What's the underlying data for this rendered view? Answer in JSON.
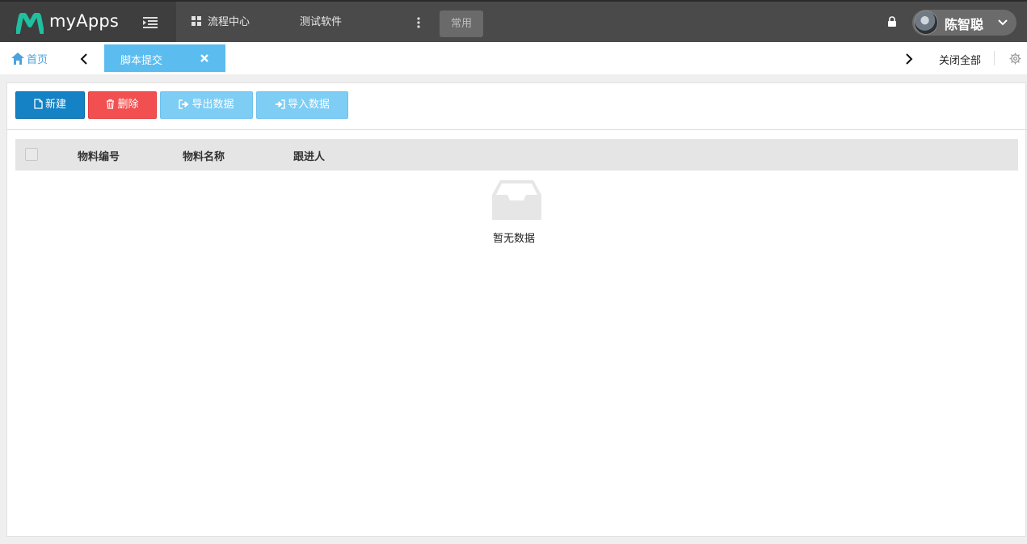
{
  "header": {
    "app_name": "myApps",
    "nav": {
      "flow_center": "流程中心",
      "test_software": "测试软件",
      "common": "常用"
    },
    "user": {
      "name": "陈智聪"
    }
  },
  "tabs": {
    "home": "首页",
    "active": "脚本提交",
    "close_all": "关闭全部"
  },
  "toolbar": {
    "new": "新建",
    "delete": "删除",
    "export": "导出数据",
    "import": "导入数据"
  },
  "table": {
    "columns": [
      "物料编号",
      "物料名称",
      "跟进人"
    ],
    "rows": [],
    "empty_text": "暂无数据"
  },
  "colors": {
    "topbar": "#4a4a4a",
    "brand_teal": "#1fbfa0",
    "primary": "#1482c4",
    "danger": "#f25050",
    "info": "#7dcdf5",
    "active_tab": "#5bbcf0"
  }
}
